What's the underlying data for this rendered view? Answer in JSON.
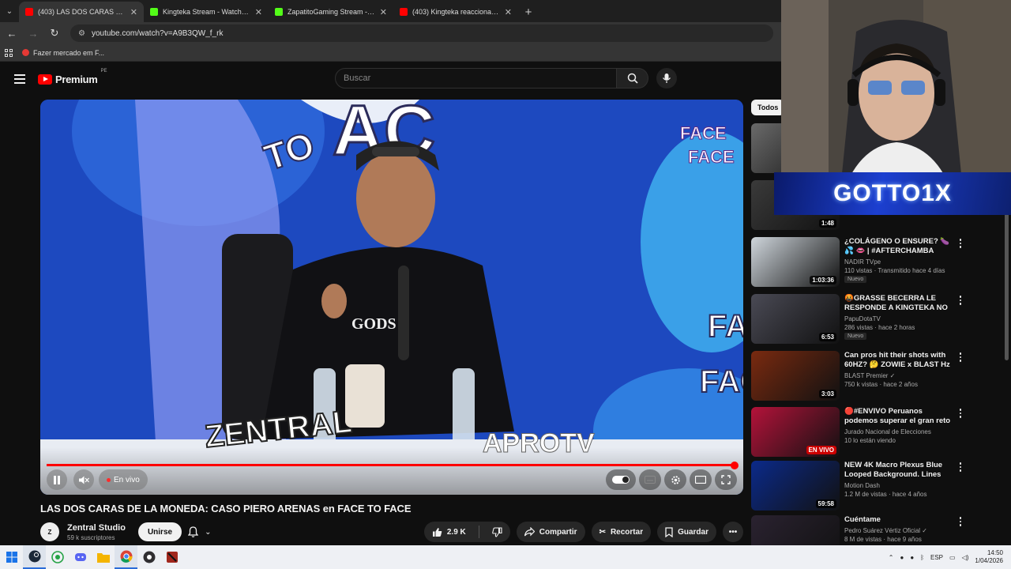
{
  "browser": {
    "tabs": [
      {
        "title": "(403) LAS DOS CARAS DE LA M",
        "favicon_color": "#ff0000",
        "active": true
      },
      {
        "title": "Kingteka Stream - Watch Live o",
        "favicon_color": "#53fc18",
        "active": false
      },
      {
        "title": "ZapatitoGaming Stream - Watc",
        "favicon_color": "#53fc18",
        "active": false
      },
      {
        "title": "(403) Kingteka reacciona con su",
        "favicon_color": "#ff0000",
        "active": false
      }
    ],
    "url": "youtube.com/watch?v=A9B3QW_f_rk",
    "bookmark": "Fazer mercado em F..."
  },
  "youtube": {
    "logo_text": "Premium",
    "country_code": "PE",
    "search_placeholder": "Buscar"
  },
  "player": {
    "live_label": "En vivo",
    "progress_percent": 99.6
  },
  "video": {
    "title": "LAS DOS CARAS DE LA MONEDA: CASO PIERO ARENAS en FACE TO FACE",
    "channel": "Zentral Studio",
    "subscribers": "59 k suscriptores",
    "avatar_text": "Z",
    "join_label": "Unirse",
    "likes": "2.9 K",
    "share_label": "Compartir",
    "clip_label": "Recortar",
    "save_label": "Guardar"
  },
  "sidebar": {
    "chip": "Todos",
    "items": [
      {
        "title": "",
        "channel": "",
        "meta": "",
        "duration": "",
        "new": false,
        "thumb_color": "#6a6a6a"
      },
      {
        "title": "",
        "channel": "",
        "meta": "",
        "duration": "1:48",
        "new": false,
        "thumb_color": "#3a3a3a"
      },
      {
        "title": "¿COLÁGENO O ENSURE? 🍆💦 👄 | #AFTERCHAMBA",
        "channel": "NADIR TVpe",
        "meta": "110 vistas · Transmitido hace 4 días",
        "duration": "1:03:36",
        "new": true,
        "thumb_color": "#cfd6dc"
      },
      {
        "title": "🤬GRASSE BECERRA LE RESPONDE A KINGTEKA NO ...",
        "channel": "PapuDotaTV",
        "meta": "286 vistas · hace 2 horas",
        "duration": "6:53",
        "new": true,
        "thumb_color": "#4a4a55"
      },
      {
        "title": "Can pros hit their shots with 60HZ? 🤔 ZOWIE x BLAST Hz ...",
        "channel": "BLAST Premier ✓",
        "meta": "750 k vistas · hace 2 años",
        "duration": "3:03",
        "new": false,
        "thumb_color": "#7a2a10"
      },
      {
        "title": "🔴#ENVIVO Peruanos podemos superar el gran reto ...",
        "channel": "Jurado Nacional de Elecciones",
        "meta": "10 lo están viendo",
        "duration": "EN VIVO",
        "new": false,
        "thumb_color": "#b4123a"
      },
      {
        "title": "NEW 4K Macro Plexus Blue Looped Background. Lines an...",
        "channel": "Motion Dash",
        "meta": "1.2 M de vistas · hace 4 años",
        "duration": "59:58",
        "new": false,
        "thumb_color": "#0b2a8a"
      },
      {
        "title": "Cuéntame",
        "channel": "Pedro Suárez Vértiz Oficial ✓",
        "meta": "8 M de vistas · hace 9 años",
        "duration": "",
        "new": false,
        "thumb_color": "#2a2230"
      }
    ]
  },
  "overlay": {
    "streamer_name": "GOTTO1X"
  },
  "taskbar": {
    "language": "ESP",
    "time": "14:50",
    "date": "1/04/2026"
  }
}
